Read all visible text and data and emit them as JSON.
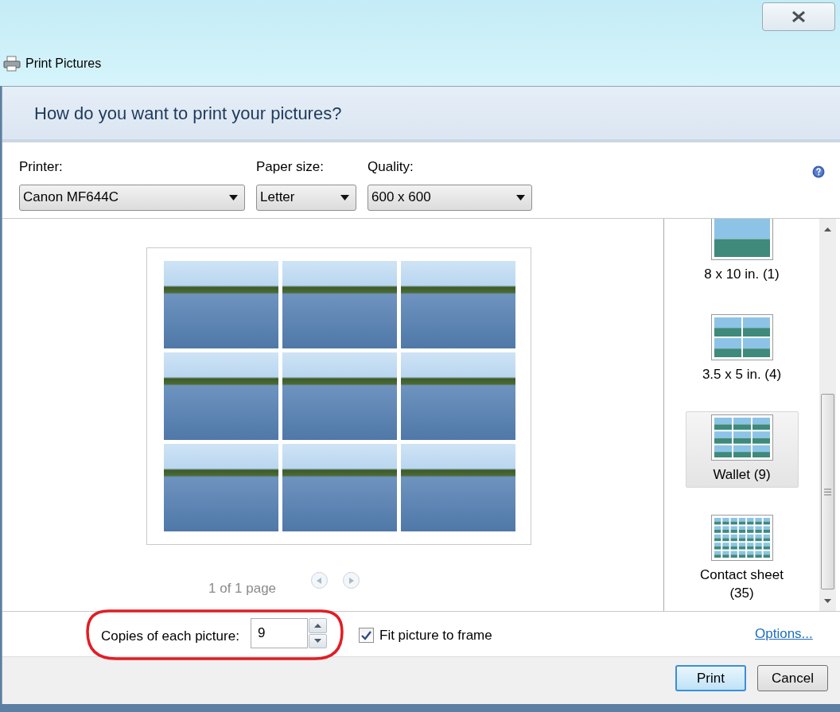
{
  "window": {
    "title": "Print Pictures"
  },
  "heading": "How do you want to print your pictures?",
  "dropdowns": [
    {
      "label": "Printer:",
      "value": "Canon MF644C"
    },
    {
      "label": "Paper size:",
      "value": "Letter"
    },
    {
      "label": "Quality:",
      "value": "600 x 600"
    }
  ],
  "layouts": [
    {
      "label": "8 x 10 in. (1)",
      "kind": "single",
      "selected": false
    },
    {
      "label": "3.5 x 5 in. (4)",
      "kind": "quad",
      "selected": false
    },
    {
      "label": "Wallet (9)",
      "kind": "wallet",
      "selected": true
    },
    {
      "label": "Contact sheet (35)",
      "kind": "contact",
      "selected": false
    }
  ],
  "page_indicator": "1 of 1 page",
  "copies": {
    "label": "Copies of each picture:",
    "value": "9"
  },
  "fit_to_frame": {
    "label": "Fit picture to frame",
    "checked": true
  },
  "options_link": "Options...",
  "buttons": [
    {
      "label": "Print",
      "default": true
    },
    {
      "label": "Cancel",
      "default": false
    }
  ],
  "annotation": {
    "kind": "highlight-ellipse"
  }
}
